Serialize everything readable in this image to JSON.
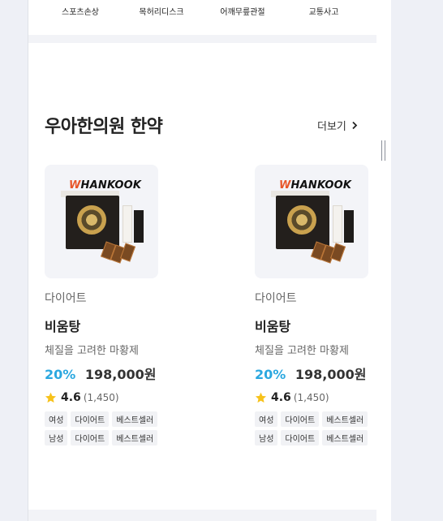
{
  "categories": [
    "스포츠손상",
    "목허리디스크",
    "어깨무릎관절",
    "교통사고"
  ],
  "section": {
    "title": "우아한의원 한약",
    "more_label": "더보기"
  },
  "products": [
    {
      "brand": "HANKOOK",
      "category": "다이어트",
      "name": "비움탕",
      "description": "체질을 고려한 마황제",
      "discount": "20%",
      "price": "198,000원",
      "rating": "4.6",
      "review_count": "(1,450)",
      "tags": [
        "여성",
        "다이어트",
        "베스트셀러",
        "남성",
        "다이어트",
        "베스트셀러"
      ]
    },
    {
      "brand": "HANKOOK",
      "category": "다이어트",
      "name": "비움탕",
      "description": "체질을 고려한 마황제",
      "discount": "20%",
      "price": "198,000원",
      "rating": "4.6",
      "review_count": "(1,450)",
      "tags": [
        "여성",
        "다이어트",
        "베스트셀러",
        "남성",
        "다이어트",
        "베스트셀러"
      ]
    }
  ],
  "colors": {
    "discount": "#2ba8e0",
    "star": "#f7c21a",
    "brand_accent": "#e8562a",
    "page_background": "#eef0f6"
  },
  "icons": {
    "more": "chevron-right-icon",
    "rating": "star-icon"
  }
}
